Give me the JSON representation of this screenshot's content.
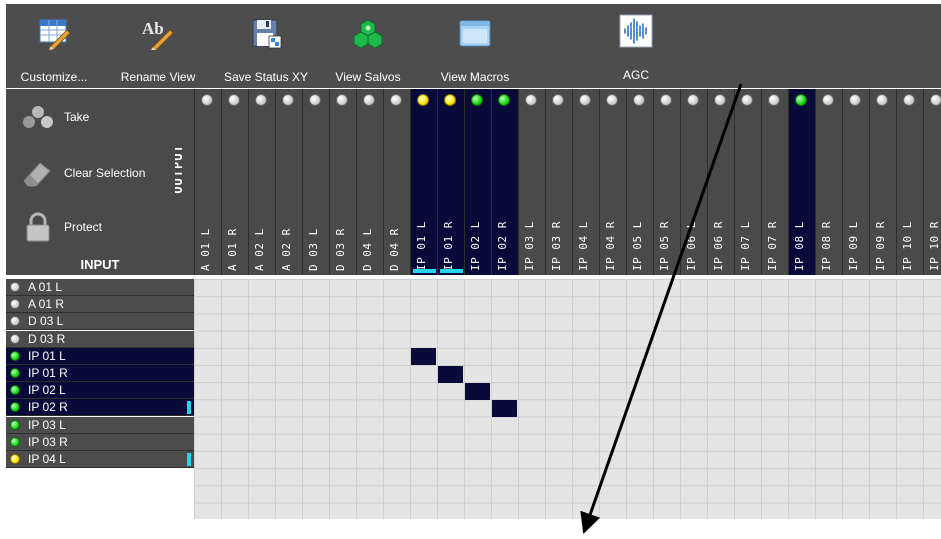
{
  "toolbar": {
    "buttons": [
      {
        "label": "Customize...",
        "icon": "table-edit-icon"
      },
      {
        "label": "Rename View",
        "icon": "rename-pencil-icon"
      },
      {
        "label": "Save Status XY",
        "icon": "save-disk-icon"
      },
      {
        "label": "View Salvos",
        "icon": "salvos-icon"
      },
      {
        "label": "View Macros",
        "icon": "macros-window-icon"
      },
      {
        "label": "AGC",
        "icon": "waveform-icon"
      }
    ]
  },
  "side": {
    "take_label": "Take",
    "clear_label": "Clear Selection",
    "protect_label": "Protect",
    "output_label": "OUTPUT",
    "input_label": "INPUT"
  },
  "outputs": [
    {
      "label": "A 01 L",
      "status": "gray"
    },
    {
      "label": "A 01 R",
      "status": "gray"
    },
    {
      "label": "A 02 L",
      "status": "gray"
    },
    {
      "label": "A 02 R",
      "status": "gray"
    },
    {
      "label": "D 03 L",
      "status": "gray"
    },
    {
      "label": "D 03 R",
      "status": "gray"
    },
    {
      "label": "D 04 L",
      "status": "gray"
    },
    {
      "label": "D 04 R",
      "status": "gray"
    },
    {
      "label": "IP 01 L",
      "status": "yellow",
      "active": true,
      "marker": true
    },
    {
      "label": "IP 01 R",
      "status": "yellow",
      "active": true,
      "marker": true
    },
    {
      "label": "IP 02 L",
      "status": "green",
      "active": true
    },
    {
      "label": "IP 02 R",
      "status": "green",
      "active": true
    },
    {
      "label": "IP 03 L",
      "status": "gray"
    },
    {
      "label": "IP 03 R",
      "status": "gray"
    },
    {
      "label": "IP 04 L",
      "status": "gray"
    },
    {
      "label": "IP 04 R",
      "status": "gray"
    },
    {
      "label": "IP 05 L",
      "status": "gray"
    },
    {
      "label": "IP 05 R",
      "status": "gray"
    },
    {
      "label": "IP 06 L",
      "status": "gray"
    },
    {
      "label": "IP 06 R",
      "status": "gray"
    },
    {
      "label": "IP 07 L",
      "status": "gray"
    },
    {
      "label": "IP 07 R",
      "status": "gray"
    },
    {
      "label": "IP 08 L",
      "status": "green",
      "active": true
    },
    {
      "label": "IP 08 R",
      "status": "gray"
    },
    {
      "label": "IP 09 L",
      "status": "gray"
    },
    {
      "label": "IP 09 R",
      "status": "gray"
    },
    {
      "label": "IP 10 L",
      "status": "gray"
    },
    {
      "label": "IP 10 R",
      "status": "gray"
    }
  ],
  "inputs": [
    {
      "label": "A 01 L",
      "status": "gray"
    },
    {
      "label": "A 01 R",
      "status": "gray"
    },
    {
      "label": "D 03 L",
      "status": "gray"
    },
    {
      "label": "D 03 R",
      "status": "gray"
    },
    {
      "label": "IP 01 L",
      "status": "green",
      "active": true
    },
    {
      "label": "IP 01 R",
      "status": "green",
      "active": true
    },
    {
      "label": "IP 02 L",
      "status": "green",
      "active": true
    },
    {
      "label": "IP 02 R",
      "status": "green",
      "active": true,
      "marker": true
    },
    {
      "label": "IP 03 L",
      "status": "green"
    },
    {
      "label": "IP 03 R",
      "status": "green"
    },
    {
      "label": "IP 04 L",
      "status": "yellow",
      "marker": true
    }
  ],
  "crosspoints": [
    {
      "row": 4,
      "col": 8
    },
    {
      "row": 5,
      "col": 9
    },
    {
      "row": 6,
      "col": 10
    },
    {
      "row": 7,
      "col": 11
    }
  ],
  "colors": {
    "panel": "#4a4a4a",
    "active": "#0a0a3a",
    "grid": "#e4e4e4",
    "accent": "#22d6ee"
  }
}
